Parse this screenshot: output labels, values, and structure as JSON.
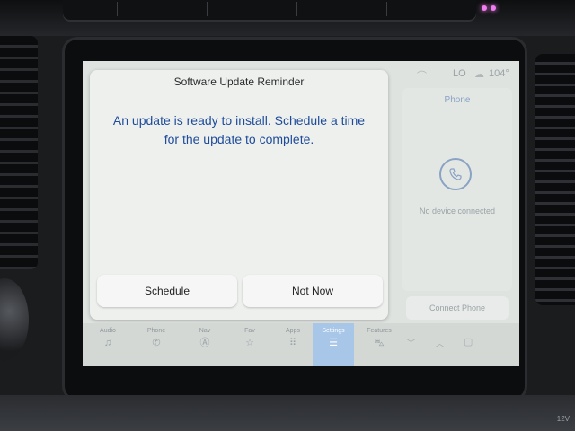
{
  "status_bar": {
    "climate_level": "LO",
    "temperature": "104°"
  },
  "dialog": {
    "title": "Software Update Reminder",
    "message": "An update is ready to install. Schedule a time for the update to complete.",
    "schedule_label": "Schedule",
    "not_now_label": "Not Now"
  },
  "phone_panel": {
    "title": "Phone",
    "status": "No device connected",
    "connect_label": "Connect Phone"
  },
  "nav": {
    "items": [
      {
        "label": "Audio",
        "icon": "music-note-icon",
        "glyph": "♫"
      },
      {
        "label": "Phone",
        "icon": "phone-icon",
        "glyph": "✆"
      },
      {
        "label": "Nav",
        "icon": "compass-icon",
        "glyph": "Ⓐ"
      },
      {
        "label": "Fav",
        "icon": "star-icon",
        "glyph": "☆"
      },
      {
        "label": "Apps",
        "icon": "apps-grid-icon",
        "glyph": "⠿"
      },
      {
        "label": "Settings",
        "icon": "settings-sliders-icon",
        "glyph": "☰"
      },
      {
        "label": "Features",
        "icon": "car-icon",
        "glyph": "⛍"
      }
    ],
    "active": "Settings"
  },
  "colors": {
    "message_text": "#1f4c9a",
    "accent": "#a8c6e8",
    "screen_bg": "#dfe3e0"
  },
  "vehicle": {
    "bottom_label": "12V"
  }
}
